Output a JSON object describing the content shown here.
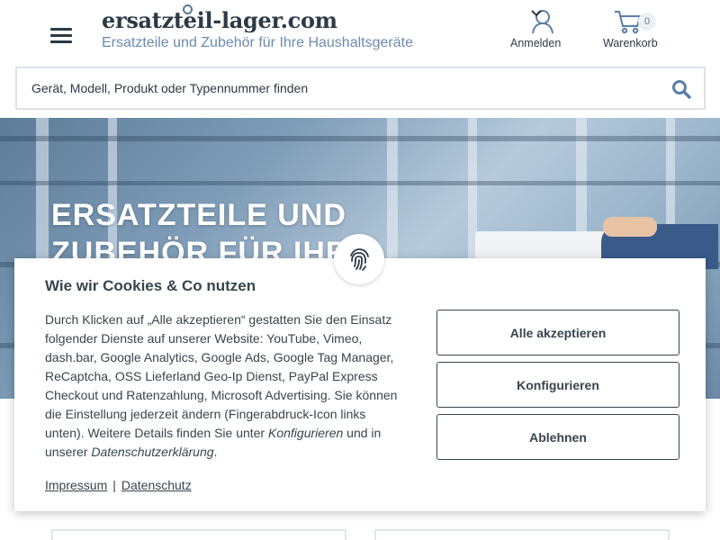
{
  "header": {
    "logo": "ersatzteil-lager.com",
    "tagline": "Ersatzteile und Zubehör für Ihre Haushaltsgeräte",
    "account_label": "Anmelden",
    "cart_label": "Warenkorb",
    "cart_count": "0"
  },
  "search": {
    "placeholder": "Gerät, Modell, Produkt oder Typennummer finden"
  },
  "hero": {
    "title_line1": "ERSATZTEILE UND",
    "title_line2": "ZUBEHÖR FÜR IHR"
  },
  "cookie": {
    "title": "Wie wir Cookies & Co nutzen",
    "text_main": "Durch Klicken auf „Alle akzeptieren“ gestatten Sie den Einsatz folgender Dienste auf unserer Website: YouTube, Vimeo, dash.bar, Google Analytics, Google Ads, Google Tag Manager, ReCaptcha, OSS Lieferland Geo-Ip Dienst, PayPal Express Checkout und Ratenzahlung, Microsoft Advertising. Sie können die Einstellung jederzeit ändern (Fingerabdruck-Icon links unten). Weitere Details finden Sie unter ",
    "text_configure": "Konfigurieren",
    "text_and": " und in unserer ",
    "text_privacy": "Datenschutzerklärung",
    "text_end": ".",
    "accept_all": "Alle akzeptieren",
    "configure": "Konfigurieren",
    "decline": "Ablehnen",
    "imprint": "Impressum",
    "separator": "|",
    "privacy": "Datenschutz"
  },
  "colors": {
    "text": "#36454f",
    "accent": "#6b8bb0",
    "icon": "#5a7fa8"
  },
  "icons": [
    "menu-icon",
    "user-icon",
    "chevron-down-icon",
    "cart-icon",
    "search-icon",
    "fingerprint-icon"
  ]
}
